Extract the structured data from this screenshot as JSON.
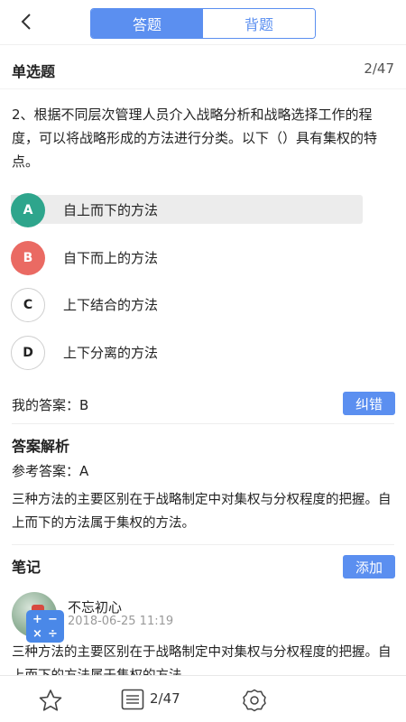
{
  "header": {
    "tabs": [
      "答题",
      "背题"
    ],
    "active_tab": 0
  },
  "question": {
    "type": "单选题",
    "counter": "2/47",
    "stem": "2、根据不同层次管理人员介入战略分析和战略选择工作的程度，可以将战略形成的方法进行分类。以下（）具有集权的特点。",
    "options": [
      {
        "letter": "A",
        "text": "自上而下的方法",
        "state": "correct"
      },
      {
        "letter": "B",
        "text": "自下而上的方法",
        "state": "wrong"
      },
      {
        "letter": "C",
        "text": "上下结合的方法",
        "state": "normal"
      },
      {
        "letter": "D",
        "text": "上下分离的方法",
        "state": "normal"
      }
    ]
  },
  "answer": {
    "my_answer": "我的答案：B",
    "report_button": "纠错"
  },
  "analysis": {
    "title": "答案解析",
    "reference": "参考答案：A",
    "text": "三种方法的主要区别在于战略制定中对集权与分权程度的把握。自上而下的方法属于集权的方法。"
  },
  "notes": {
    "title": "笔记",
    "add_button": "添加",
    "items": [
      {
        "user": "不忘初心",
        "date": "2018-06-25 11:19",
        "text": "三种方法的主要区别在于战略制定中对集权与分权程度的把握。自上而下的方法属于集权的方法。"
      }
    ]
  },
  "footer": {
    "page": "2/47",
    "icons": [
      "star-icon",
      "answer-sheet-icon",
      "settings-icon"
    ]
  },
  "colors": {
    "accent": "#5b8ff0",
    "correct": "#2ea58c",
    "wrong": "#ea6a63",
    "calc": "#4a88e8"
  }
}
